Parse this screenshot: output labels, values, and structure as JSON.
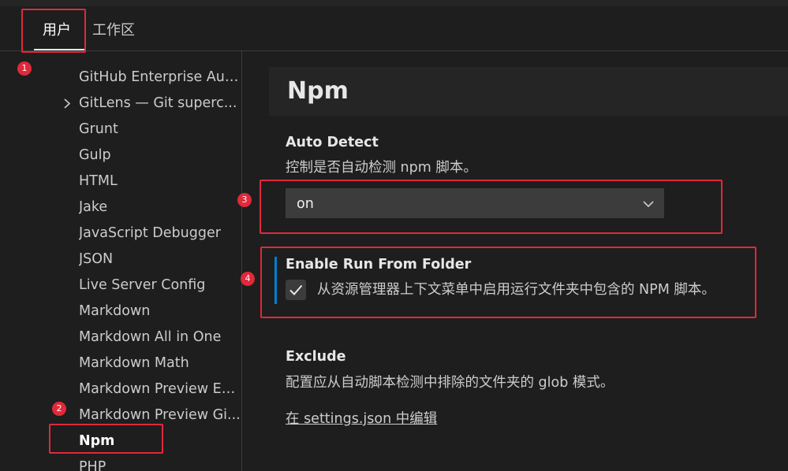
{
  "tabs": {
    "user": "用户",
    "workspace": "工作区"
  },
  "toc": {
    "items": [
      {
        "label": "GitHub Enterprise Aut...",
        "active": false
      },
      {
        "label": "GitLens — Git superc...",
        "active": false,
        "expandable": true
      },
      {
        "label": "Grunt",
        "active": false
      },
      {
        "label": "Gulp",
        "active": false
      },
      {
        "label": "HTML",
        "active": false
      },
      {
        "label": "Jake",
        "active": false
      },
      {
        "label": "JavaScript Debugger",
        "active": false
      },
      {
        "label": "JSON",
        "active": false
      },
      {
        "label": "Live Server Config",
        "active": false
      },
      {
        "label": "Markdown",
        "active": false
      },
      {
        "label": "Markdown All in One",
        "active": false
      },
      {
        "label": "Markdown Math",
        "active": false
      },
      {
        "label": "Markdown Preview En...",
        "active": false
      },
      {
        "label": "Markdown Preview Gi...",
        "active": false
      },
      {
        "label": "Npm",
        "active": true
      },
      {
        "label": "PHP",
        "active": false
      }
    ]
  },
  "section": {
    "title": "Npm"
  },
  "settings": {
    "auto_detect": {
      "title": "Auto Detect",
      "description": "控制是否自动检测 npm 脚本。",
      "value": "on"
    },
    "run_from_folder": {
      "title": "Enable Run From Folder",
      "description": "从资源管理器上下文菜单中启用运行文件夹中包含的 NPM 脚本。",
      "checked": true
    },
    "exclude": {
      "title": "Exclude",
      "description": "配置应从自动脚本检测中排除的文件夹的 glob 模式。",
      "link": "在 settings.json 中编辑"
    }
  },
  "annotations": {
    "markers": [
      "1",
      "2",
      "3",
      "4"
    ],
    "color": "#e0293a"
  },
  "colors": {
    "background": "#1e1e1e",
    "header_background": "#252526",
    "accent": "#007fd4",
    "input_background": "#3c3c3c"
  }
}
